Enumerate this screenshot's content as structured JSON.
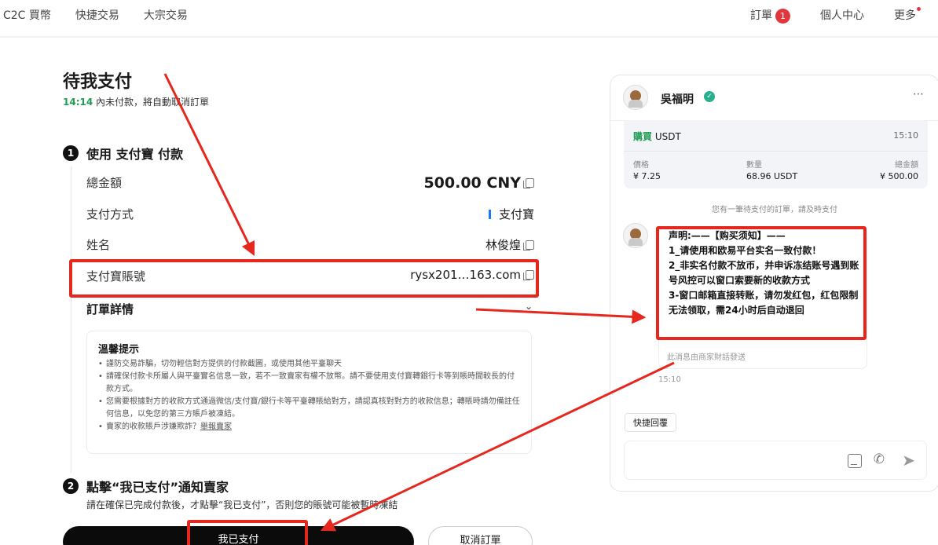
{
  "nav": {
    "items": [
      "C2C 買幣",
      "快捷交易",
      "大宗交易"
    ],
    "orders_label": "訂單",
    "orders_count": "1",
    "profile_label": "個人中心",
    "more_label": "更多"
  },
  "page": {
    "title": "待我支付",
    "countdown": "14:14",
    "countdown_suffix": "內未付款，將自動取消訂單"
  },
  "step1": {
    "num": "1",
    "title": "使用 支付寶 付款",
    "rows": [
      {
        "label": "總金額",
        "value": "500.00 CNY"
      },
      {
        "label": "支付方式",
        "value": "支付寶"
      },
      {
        "label": "姓名",
        "value": "林俊煌"
      },
      {
        "label": "支付寶賬號",
        "value": "rysx201…163.com"
      }
    ],
    "details_label": "訂單詳情"
  },
  "tips": {
    "title": "溫馨提示",
    "items": [
      "謹防交易詐騙，切勿輕信對方提供的付款截圖，或使用其他平臺聊天",
      "請確保付款卡所屬人與平臺實名信息一致，若不一致賣家有權不放幣。請不要使用支付寶轉銀行卡等到賬時間較長的付款方式。",
      "您需要根據對方的收款方式通過微信/支付寶/銀行卡等平臺轉賬給對方，請認真核對對方的收款信息；轉賬時請勿備註任何信息，以免您的第三方賬戶被凍結。",
      "賣家的收款賬戶涉嫌欺詐？"
    ],
    "report_link": "舉報賣家"
  },
  "step2": {
    "num": "2",
    "title": "點擊“我已支付”通知賣家",
    "subtitle": "請在確保已完成付款後，才點擊“我已支付”，否則您的賬號可能被暫時凍結"
  },
  "buttons": {
    "paid": "我已支付",
    "cancel": "取消訂單"
  },
  "chat": {
    "merchant_name": "吳福明",
    "order": {
      "side": "購買",
      "asset": "USDT",
      "time": "15:10",
      "price_label": "價格",
      "price": "¥ 7.25",
      "qty_label": "數量",
      "qty": "68.96 USDT",
      "total_label": "總金額",
      "total": "¥ 500.00"
    },
    "system_note": "您有一筆待支付的訂單，請及時支付",
    "message": "声明:——【购买须知】——\n1_请使用和欧易平台实名一致付款！\n2_非实名付款不放币，并申诉冻结账号遇到账号风控可以窗口索要新的收款方式\n3-窗口邮箱直接转账，请勿发红包，红包限制无法领取，需24小时后自动退回",
    "message_footer": "此消息由商家財話發送",
    "message_time": "15:10",
    "quick_reply": "快捷回覆"
  },
  "colors": {
    "annotation": "#e5271f",
    "success": "#1f9d55",
    "badge": "#e0383e"
  }
}
